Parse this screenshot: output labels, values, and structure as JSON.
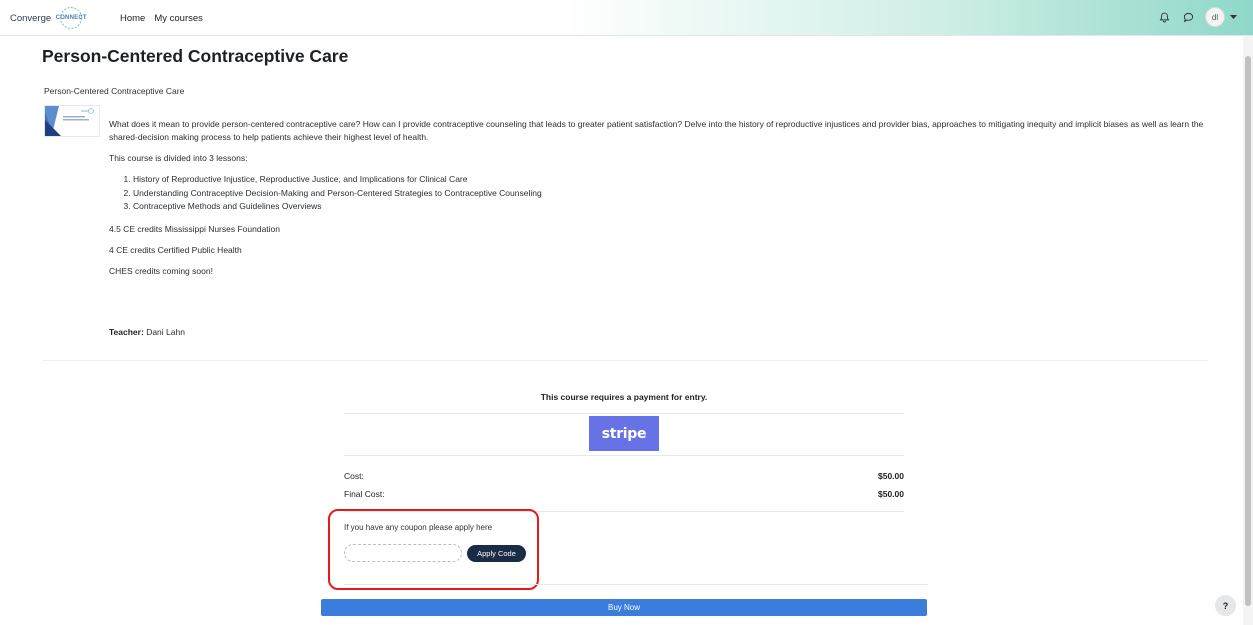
{
  "navbar": {
    "logo_text": "Converge",
    "logo_badge": "CONNECT",
    "links": [
      "Home",
      "My courses"
    ],
    "avatar_initials": "dl",
    "icons": [
      "bell-icon",
      "chat-icon",
      "chevron-down-icon"
    ]
  },
  "course": {
    "title": "Person-Centered Contraceptive Care",
    "name": "Person-Centered Contraceptive Care",
    "summary_p1": "What does it mean to provide person-centered contraceptive care? How can I provide contraceptive counseling that leads to greater patient satisfaction? Delve into the history of reproductive injustices and provider bias, approaches to mitigating inequity and implicit biases as well as learn the shared-decision making process to help patients achieve their highest level of health.",
    "summary_p2": "This course is divided into 3 lessons:",
    "lessons": [
      "History of Reproductive Injustice, Reproductive Justice, and Implications for Clinical Care",
      "Understanding Contraceptive Decision-Making and Person-Centered Strategies to Contraceptive Counseling",
      "Contraceptive Methods and Guidelines Overviews"
    ],
    "credits": [
      "4.5 CE credits Mississippi Nurses Foundation",
      "4 CE credits Certified Public Health",
      "CHES credits coming soon!"
    ],
    "teacher_label": "Teacher:",
    "teacher_name": "Dani Lahn"
  },
  "payment": {
    "heading": "This course requires a payment for entry.",
    "provider_label": "stripe",
    "cost_label": "Cost:",
    "cost_value": "$50.00",
    "final_cost_label": "Final Cost:",
    "final_cost_value": "$50.00",
    "coupon_prompt": "If you have any coupon please apply here",
    "coupon_value": "",
    "apply_label": "Apply Code",
    "buy_label": "Buy Now"
  },
  "help_label": "?",
  "colors": {
    "stripe": "#6772e5",
    "buy_button": "#3b7ddd",
    "apply_button": "#1a2b46",
    "highlight": "#e31b1b"
  }
}
